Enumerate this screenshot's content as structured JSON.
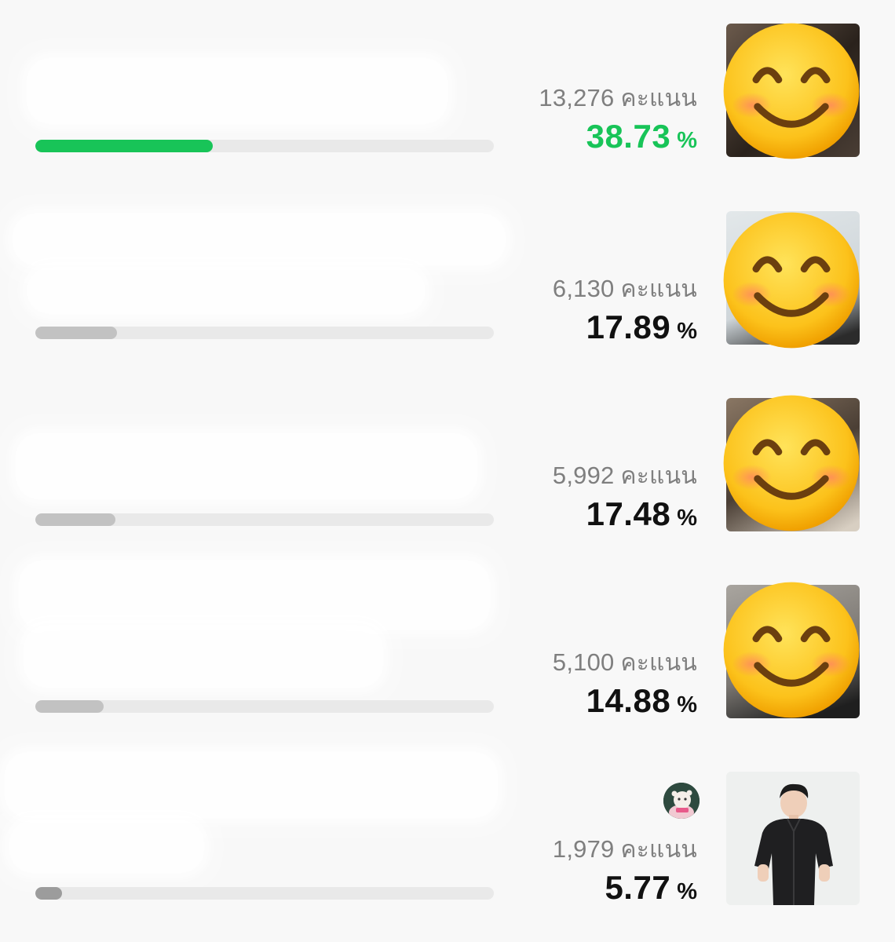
{
  "poll": {
    "unit_label": "คะแนน",
    "percent_sign": "%",
    "accent_color": "#18c458",
    "candidates": [
      {
        "rank": 1,
        "name": "",
        "score": "13,276",
        "percent": "38.73",
        "share": 0.3873,
        "photo_icon": "smiling-face-emoji"
      },
      {
        "rank": 2,
        "name": "",
        "score": "6,130",
        "percent": "17.89",
        "share": 0.1789,
        "photo_icon": "smiling-face-emoji"
      },
      {
        "rank": 3,
        "name": "",
        "score": "5,992",
        "percent": "17.48",
        "share": 0.1748,
        "photo_icon": "smiling-face-emoji"
      },
      {
        "rank": 4,
        "name": "",
        "score": "5,100",
        "percent": "14.88",
        "share": 0.1488,
        "photo_icon": "smiling-face-emoji"
      },
      {
        "rank": 5,
        "name": "",
        "score": "1,979",
        "percent": "5.77",
        "share": 0.0577,
        "photo_icon": "person-photo",
        "voter_icon": "user-avatar-icon"
      }
    ]
  }
}
